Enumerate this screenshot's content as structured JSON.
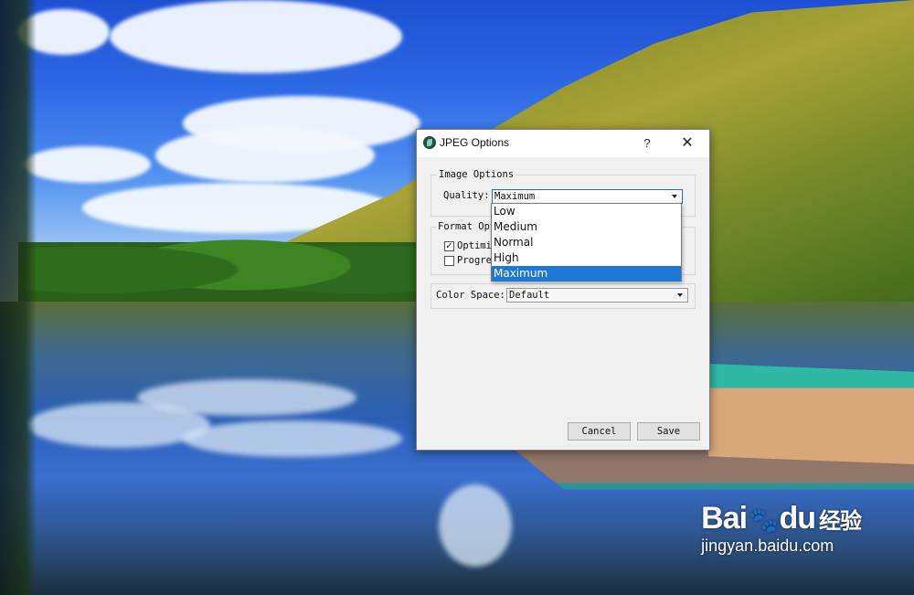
{
  "dialog": {
    "title": "JPEG Options",
    "help": "?",
    "close": "✕",
    "image_options": {
      "label": "Image Options",
      "quality_label": "Quality:",
      "quality_value": "Maximum"
    },
    "format_options": {
      "label": "Format Opt",
      "optimized_label": "Optimi",
      "optimized_checked": "✓",
      "progressive_label": "Progre"
    },
    "color_space": {
      "label": "Color Space:",
      "value": "Default"
    },
    "cancel": "Cancel",
    "save": "Save"
  },
  "quality_dropdown": {
    "options": [
      "Low",
      "Medium",
      "Normal",
      "High",
      "Maximum"
    ],
    "selected": "Maximum"
  },
  "watermark": {
    "brand_left": "Bai",
    "brand_right": "du",
    "paw": "🐾",
    "cn": "经验",
    "url": "jingyan.baidu.com"
  },
  "colors": {
    "accent": "#1c78d4",
    "focus_border": "#1c6fd0",
    "dialog_bg": "#f0f0f0"
  }
}
